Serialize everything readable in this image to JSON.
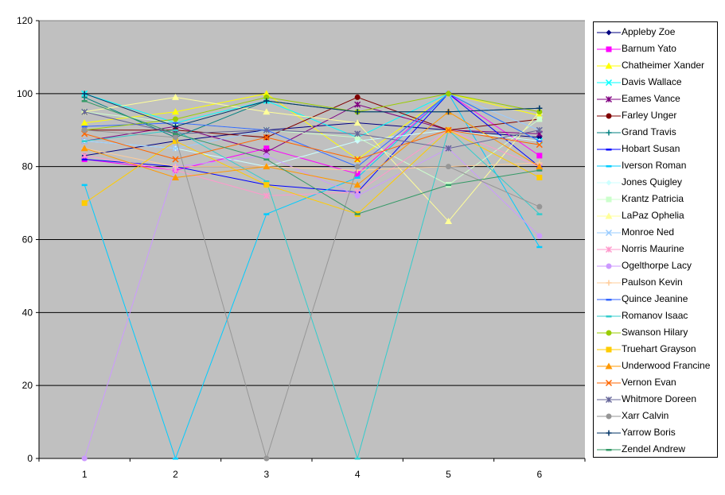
{
  "chart_data": {
    "type": "line",
    "title": "",
    "xlabel": "",
    "ylabel": "",
    "x": [
      1,
      2,
      3,
      4,
      5,
      6
    ],
    "categories": [
      "1",
      "2",
      "3",
      "4",
      "5",
      "6"
    ],
    "ylim": [
      0,
      120
    ],
    "yticks": [
      0,
      20,
      40,
      60,
      80,
      100,
      120
    ],
    "grid": true,
    "legend_position": "right",
    "plot_background": "#C0C0C0",
    "series": [
      {
        "name": "Appleby Zoe",
        "color": "#000080",
        "marker": "diamond",
        "values": [
          83,
          87,
          90,
          92,
          90,
          88
        ]
      },
      {
        "name": "Barnum Yato",
        "color": "#FF00FF",
        "marker": "square",
        "values": [
          82,
          79,
          85,
          78,
          100,
          83
        ]
      },
      {
        "name": "Chatheimer Xander",
        "color": "#FFFF00",
        "marker": "triangle",
        "values": [
          92,
          95,
          100,
          82,
          100,
          94
        ]
      },
      {
        "name": "Davis Wallace",
        "color": "#00FFFF",
        "marker": "x",
        "values": [
          100,
          92,
          98,
          88,
          100,
          87
        ]
      },
      {
        "name": "Eames Vance",
        "color": "#800080",
        "marker": "star",
        "values": [
          87,
          91,
          84,
          97,
          90,
          89
        ]
      },
      {
        "name": "Farley Unger",
        "color": "#800000",
        "marker": "circle",
        "values": [
          90,
          90,
          88,
          99,
          90,
          93
        ]
      },
      {
        "name": "Grand Travis",
        "color": "#008080",
        "marker": "plus",
        "values": [
          99,
          88,
          98,
          95,
          95,
          96
        ]
      },
      {
        "name": "Hobart Susan",
        "color": "#0000FF",
        "marker": "dash",
        "values": [
          82,
          80,
          75,
          73,
          100,
          80
        ]
      },
      {
        "name": "Iverson Roman",
        "color": "#00CCFF",
        "marker": "dash",
        "values": [
          75,
          0,
          67,
          77,
          100,
          58
        ]
      },
      {
        "name": "Jones Quigley",
        "color": "#CCFFFF",
        "marker": "diamond",
        "values": [
          87,
          85,
          80,
          87,
          90,
          87
        ]
      },
      {
        "name": "Krantz Patricia",
        "color": "#CCFFCC",
        "marker": "square",
        "values": [
          95,
          92,
          90,
          88,
          75,
          93
        ]
      },
      {
        "name": "LaPaz Ophelia",
        "color": "#FFFF99",
        "marker": "triangle",
        "values": [
          95,
          99,
          95,
          92,
          65,
          95
        ]
      },
      {
        "name": "Monroe Ned",
        "color": "#99CCFF",
        "marker": "x",
        "values": [
          87,
          85,
          90,
          80,
          100,
          90
        ]
      },
      {
        "name": "Norris Maurine",
        "color": "#FF99CC",
        "marker": "star",
        "values": [
          83,
          79,
          72,
          73,
          90,
          80
        ]
      },
      {
        "name": "Ogelthorpe Lacy",
        "color": "#CC99FF",
        "marker": "circle",
        "values": [
          0,
          80,
          83,
          72,
          85,
          61
        ]
      },
      {
        "name": "Paulson Kevin",
        "color": "#FFCC99",
        "marker": "plus",
        "values": [
          85,
          80,
          80,
          79,
          80,
          81
        ]
      },
      {
        "name": "Quince Jeanine",
        "color": "#3366FF",
        "marker": "dash",
        "values": [
          91,
          92,
          90,
          80,
          100,
          87
        ]
      },
      {
        "name": "Romanov Isaac",
        "color": "#33CCCC",
        "marker": "dash",
        "values": [
          87,
          90,
          76,
          0,
          90,
          67
        ]
      },
      {
        "name": "Swanson Hilary",
        "color": "#99CC00",
        "marker": "circle",
        "values": [
          90,
          93,
          99,
          95,
          100,
          95
        ]
      },
      {
        "name": "Truehart Grayson",
        "color": "#FFCC00",
        "marker": "square",
        "values": [
          70,
          87,
          75,
          67,
          90,
          77
        ]
      },
      {
        "name": "Underwood Francine",
        "color": "#FF9900",
        "marker": "triangle",
        "values": [
          85,
          77,
          80,
          75,
          95,
          80
        ]
      },
      {
        "name": "Vernon Evan",
        "color": "#FF6600",
        "marker": "x",
        "values": [
          89,
          82,
          88,
          82,
          90,
          86
        ]
      },
      {
        "name": "Whitmore Doreen",
        "color": "#666699",
        "marker": "star",
        "values": [
          95,
          89,
          90,
          89,
          85,
          90
        ]
      },
      {
        "name": "Xarr Calvin",
        "color": "#969696",
        "marker": "circle",
        "values": [
          90,
          88,
          0,
          80,
          80,
          69
        ]
      },
      {
        "name": "Yarrow Boris",
        "color": "#003366",
        "marker": "plus",
        "values": [
          100,
          91,
          98,
          95,
          95,
          96
        ]
      },
      {
        "name": "Zendel Andrew",
        "color": "#339966",
        "marker": "dash",
        "values": [
          98,
          89,
          82,
          67,
          75,
          79
        ]
      }
    ]
  }
}
